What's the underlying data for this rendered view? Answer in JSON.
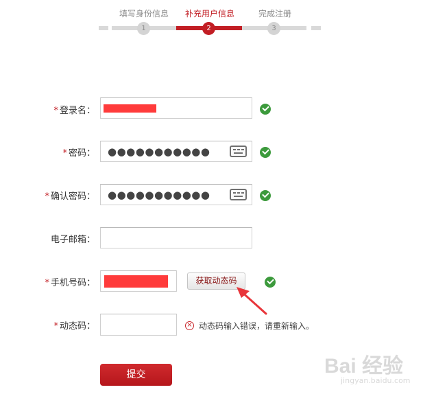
{
  "stepper": {
    "steps": [
      {
        "label": "填写身份信息",
        "number": "1",
        "active": false
      },
      {
        "label": "补充用户信息",
        "number": "2",
        "active": true
      },
      {
        "label": "完成注册",
        "number": "3",
        "active": false
      }
    ]
  },
  "form": {
    "username": {
      "required_mark": "*",
      "label": "登录名："
    },
    "password": {
      "required_mark": "*",
      "label": "密码：",
      "masked_value": "●●●●●●●●●●●"
    },
    "confirm_password": {
      "required_mark": "*",
      "label": "确认密码：",
      "masked_value": "●●●●●●●●●●●"
    },
    "email": {
      "label": "电子邮箱："
    },
    "phone": {
      "required_mark": "*",
      "label": "手机号码："
    },
    "get_code_button": "获取动态码",
    "dynamic_code": {
      "required_mark": "*",
      "label": "动态码：",
      "error": "动态码输入错误，请重新输入。"
    },
    "submit_button": "提交"
  },
  "watermark": {
    "brand": "Bai 经验",
    "url": "jingyan.baidu.com"
  },
  "colors": {
    "accent": "#c21e24",
    "success": "#3c9a3c",
    "redaction": "#ff3b3b"
  }
}
